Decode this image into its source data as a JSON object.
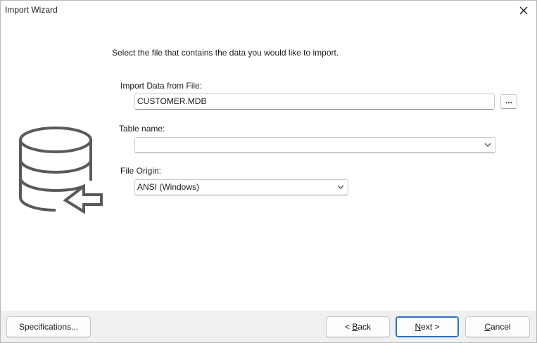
{
  "window": {
    "title": "Import Wizard"
  },
  "instruction": "Select the file that contains the data you would like to import.",
  "file": {
    "label": "Import Data from File:",
    "value": "CUSTOMER.MDB",
    "browse_label": "..."
  },
  "table": {
    "label": "Table name:",
    "value": ""
  },
  "origin": {
    "label": "File Origin:",
    "value": "ANSI (Windows)"
  },
  "footer": {
    "specifications_label": "Specifications...",
    "back_prefix": "< ",
    "back_mnemonic": "B",
    "back_rest": "ack",
    "next_mnemonic": "N",
    "next_rest": "ext >",
    "cancel_mnemonic": "C",
    "cancel_rest": "ancel"
  },
  "icons": {
    "database": "database-import-icon",
    "close": "close-icon",
    "dropdown": "chevron-down-icon"
  },
  "colors": {
    "icon_gray": "#5a5a5a",
    "footer_bg": "#f0f0f0",
    "default_button_border": "#2f6fc0"
  }
}
